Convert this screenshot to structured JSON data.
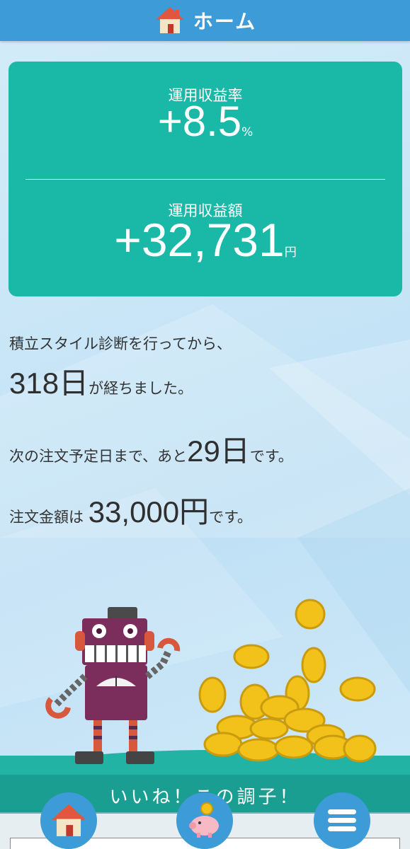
{
  "header": {
    "title": "ホーム",
    "icon": "home-icon"
  },
  "summary": {
    "rate_label": "運用収益率",
    "rate_value": "+8.5",
    "rate_unit": "%",
    "amount_label": "運用収益額",
    "amount_value": "+32,731",
    "amount_unit": "円"
  },
  "info": {
    "line1": "積立スタイル診断を行ってから、",
    "days_elapsed": "318日",
    "days_suffix": "が経ちました。",
    "next_prefix": "次の注文予定日まで、あと",
    "next_days": "29日",
    "next_suffix": "です。",
    "order_prefix": "注文金額は",
    "order_amount": "33,000円",
    "order_suffix": "です。"
  },
  "banner": {
    "text": "いいね！この調子！"
  },
  "nav": {
    "home_icon": "home-icon",
    "savings_icon": "piggy-bank-icon",
    "menu_icon": "menu-icon"
  },
  "colors": {
    "header": "#3d9bd8",
    "card": "#1ab8a6",
    "ground": "#23b3a4"
  }
}
